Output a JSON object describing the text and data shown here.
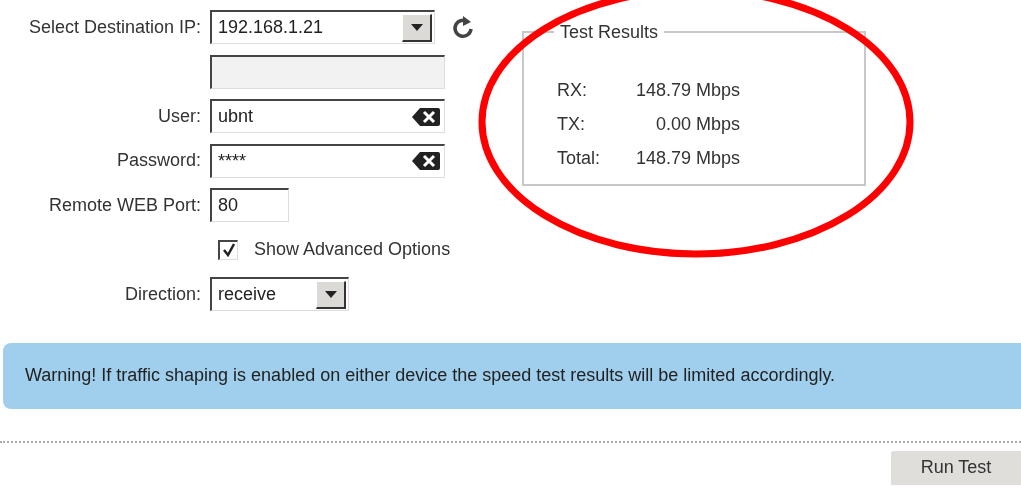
{
  "form": {
    "fields": [
      {
        "kind": "select",
        "label": "Select Destination IP:",
        "value": "192.168.1.21",
        "refresh": true
      },
      {
        "kind": "disabled"
      },
      {
        "kind": "clearable",
        "label": "User:",
        "value": "ubnt"
      },
      {
        "kind": "clearable",
        "label": "Password:",
        "value": "****"
      },
      {
        "kind": "text",
        "label": "Remote WEB Port:",
        "value": "80"
      },
      {
        "kind": "checkbox",
        "label": "Show Advanced Options",
        "checked": true
      },
      {
        "kind": "select",
        "label": "Direction:",
        "value": "receive"
      }
    ]
  },
  "results": {
    "title": "Test Results",
    "rows": [
      {
        "label": "RX:",
        "value": "148.79 Mbps"
      },
      {
        "label": "TX:",
        "value": "0.00 Mbps"
      },
      {
        "label": "Total:",
        "value": "148.79 Mbps"
      }
    ]
  },
  "warning": "Warning! If traffic shaping is enabled on either device the speed test results will be limited accordingly.",
  "run_button": "Run Test"
}
